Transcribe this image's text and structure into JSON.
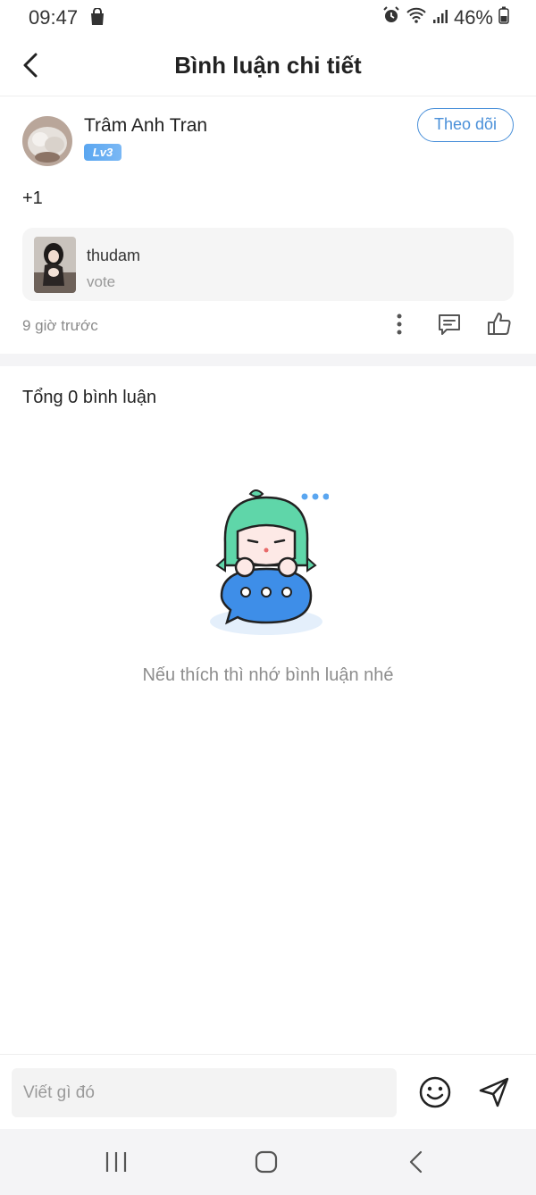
{
  "status_bar": {
    "time": "09:47",
    "battery": "46%"
  },
  "header": {
    "title": "Bình luận chi tiết"
  },
  "post": {
    "author": "Trâm Anh Tran",
    "level": "Lv3",
    "follow_label": "Theo dõi",
    "content": "+1",
    "quote": {
      "name": "thudam",
      "text": "vote"
    },
    "time_ago": "9 giờ trước"
  },
  "comments": {
    "total_label": "Tổng 0 bình luận",
    "empty_message": "Nếu thích thì nhớ bình luận nhé"
  },
  "composer": {
    "placeholder": "Viết gì đó"
  },
  "colors": {
    "accent": "#4a90d9",
    "muted": "#8d8d8d",
    "divider": "#f4f4f6"
  },
  "icons": [
    "back-icon",
    "more-icon",
    "comment-icon",
    "like-icon",
    "emoji-icon",
    "send-icon",
    "recents-icon",
    "home-icon",
    "nav-back-icon"
  ]
}
